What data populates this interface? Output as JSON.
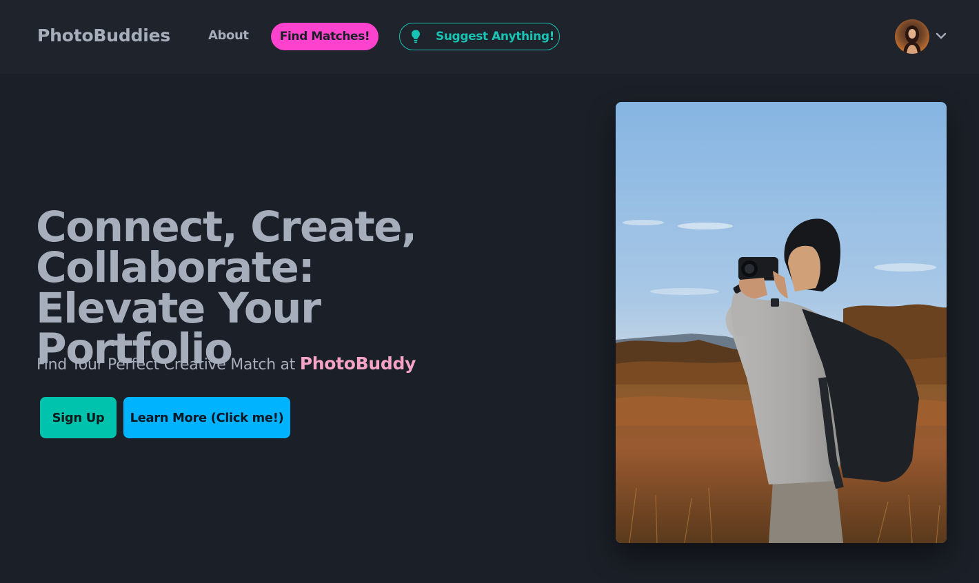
{
  "navbar": {
    "brand": "PhotoBuddies",
    "about_label": "About",
    "find_matches_label": "Find Matches!",
    "suggest_label": "Suggest Anything!",
    "suggest_icon": "lightbulb-icon",
    "avatar_icon": "user-avatar",
    "menu_icon": "chevron-down-icon"
  },
  "hero": {
    "title": "Connect, Create, Collaborate: Elevate Your Portfolio",
    "subtitle_prefix": "Find Your Perfect Creative Match at ",
    "subtitle_brand": "PhotoBuddy",
    "signup_label": "Sign Up",
    "learn_more_label": "Learn More (Click me!)",
    "image_subject": "photographer-with-camera"
  },
  "colors": {
    "background": "#1b1f27",
    "navbar": "#1f232c",
    "text": "#a6adbb",
    "pink": "#fd43cd",
    "teal": "#17c4b4",
    "signup": "#00c3ad",
    "learn_more": "#00b3ff",
    "brand_highlight": "#f5a3c7"
  }
}
